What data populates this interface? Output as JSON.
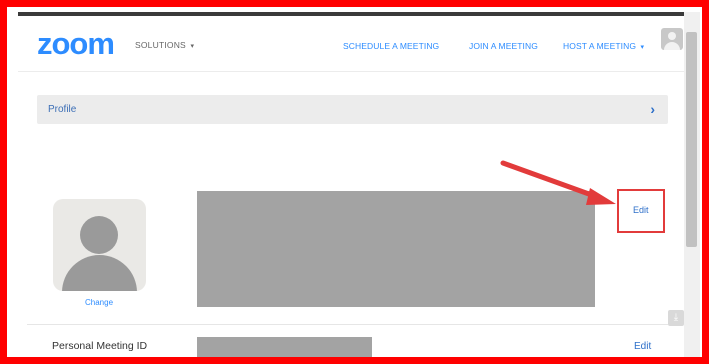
{
  "header": {
    "logo": "zoom",
    "solutions_label": "SOLUTIONS",
    "schedule_label": "SCHEDULE A MEETING",
    "join_label": "JOIN A MEETING",
    "host_label": "HOST A MEETING",
    "caret_icon": "▾"
  },
  "profile_nav": {
    "label": "Profile",
    "chevron_icon": "›"
  },
  "profile": {
    "change_label": "Change",
    "edit_label": "Edit",
    "pmi_label": "Personal Meeting ID",
    "pmi_edit_label": "Edit"
  },
  "colors": {
    "brand": "#2d8cff",
    "annotation": "#e23b3b",
    "frame": "#ff0000"
  }
}
